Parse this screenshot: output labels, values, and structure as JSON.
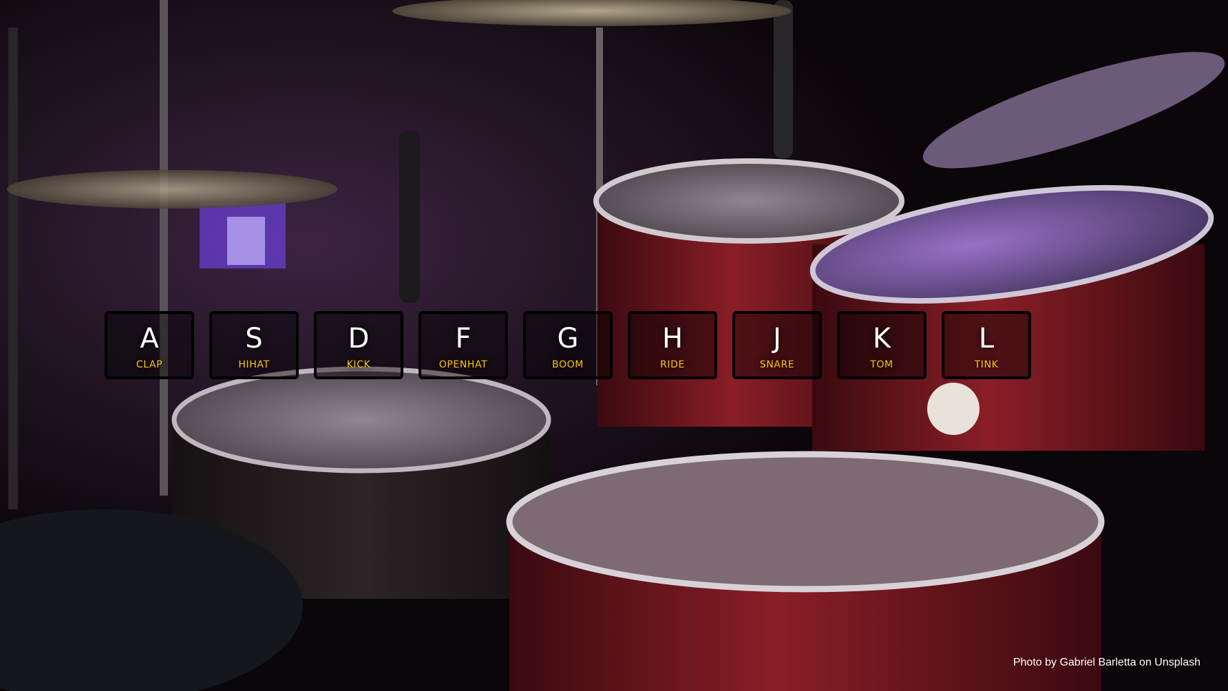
{
  "drum_keys": [
    {
      "key": "A",
      "sound": "clap"
    },
    {
      "key": "S",
      "sound": "hihat"
    },
    {
      "key": "D",
      "sound": "kick"
    },
    {
      "key": "F",
      "sound": "openhat"
    },
    {
      "key": "G",
      "sound": "boom"
    },
    {
      "key": "H",
      "sound": "ride"
    },
    {
      "key": "J",
      "sound": "snare"
    },
    {
      "key": "K",
      "sound": "tom"
    },
    {
      "key": "L",
      "sound": "tink"
    }
  ],
  "photo_credit": "Photo by Gabriel Barletta on Unsplash",
  "colors": {
    "accent": "#ffc600",
    "key_text": "#ffffff",
    "key_border": "#000000"
  }
}
